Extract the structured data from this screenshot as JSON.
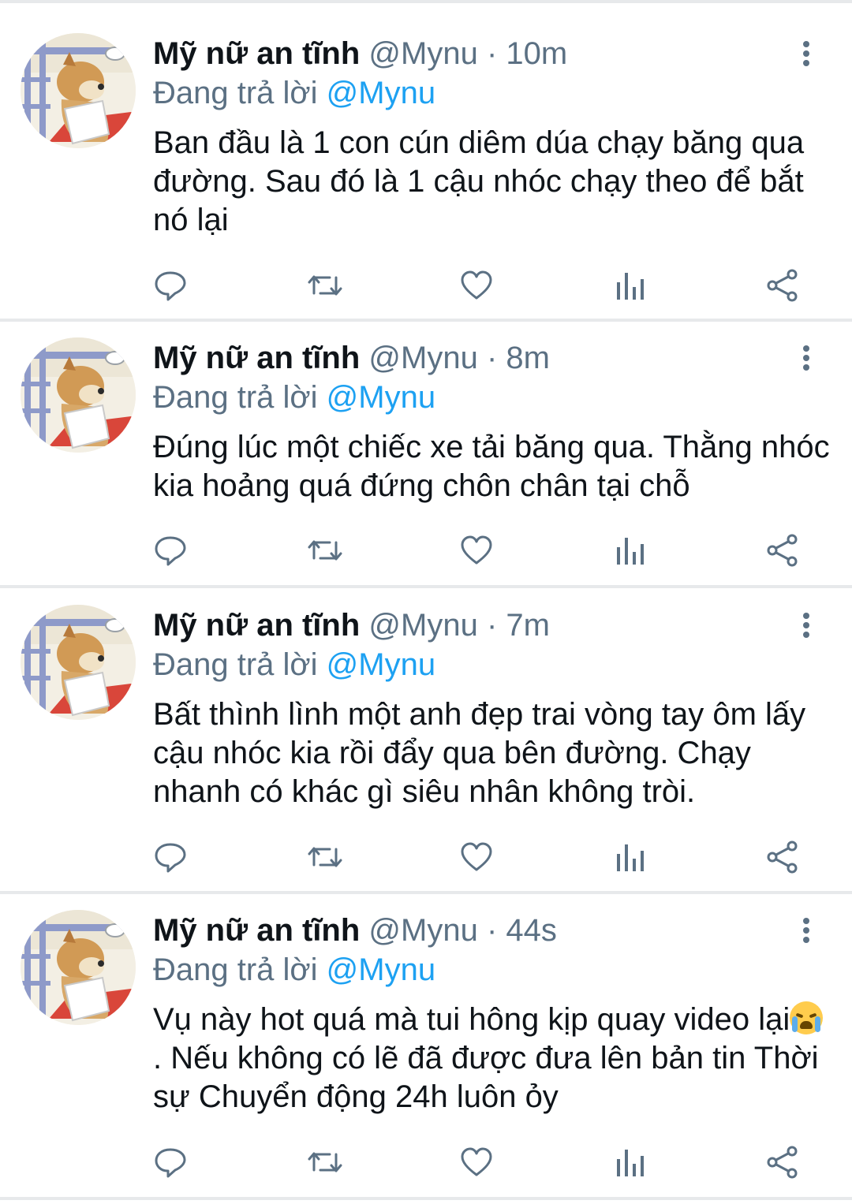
{
  "tweets": [
    {
      "name": "Mỹ nữ an tĩnh",
      "handle": "@Mynu",
      "separator": "·",
      "time": "10m",
      "reply_prefix": "Đang trả lời",
      "reply_to": "@Mynu",
      "text": "Ban đầu là 1 con cún diêm dúa chạy băng qua đường. Sau đó là 1 cậu nhóc chạy theo để bắt nó lại"
    },
    {
      "name": "Mỹ nữ an tĩnh",
      "handle": "@Mynu",
      "separator": "·",
      "time": "8m",
      "reply_prefix": "Đang trả lời",
      "reply_to": "@Mynu",
      "text": "Đúng lúc một chiếc xe tải băng qua. Thằng nhóc kia hoảng quá đứng chôn chân tại chỗ"
    },
    {
      "name": "Mỹ nữ an tĩnh",
      "handle": "@Mynu",
      "separator": "·",
      "time": "7m",
      "reply_prefix": "Đang trả lời",
      "reply_to": "@Mynu",
      "text": "Bất thình lình một anh đẹp trai vòng tay ôm lấy cậu nhóc kia rồi đẩy qua bên đường. Chạy nhanh có khác gì siêu nhân không tròi."
    },
    {
      "name": "Mỹ nữ an tĩnh",
      "handle": "@Mynu",
      "separator": "·",
      "time": "44s",
      "reply_prefix": "Đang trả lời",
      "reply_to": "@Mynu",
      "text_before": "Vụ này hot quá mà tui hông kịp quay video lại",
      "emoji": "loudly-crying-face",
      "text_after": ". Nếu không có lẽ đã được đưa lên bản tin Thời sự Chuyển động 24h luôn ỏy"
    }
  ],
  "action_icons": [
    "reply-icon",
    "retweet-icon",
    "like-icon",
    "analytics-icon",
    "share-icon"
  ],
  "colors": {
    "text": "#0f1419",
    "secondary": "#5b7083",
    "link": "#1da1f2",
    "divider": "#e7e9eb"
  }
}
